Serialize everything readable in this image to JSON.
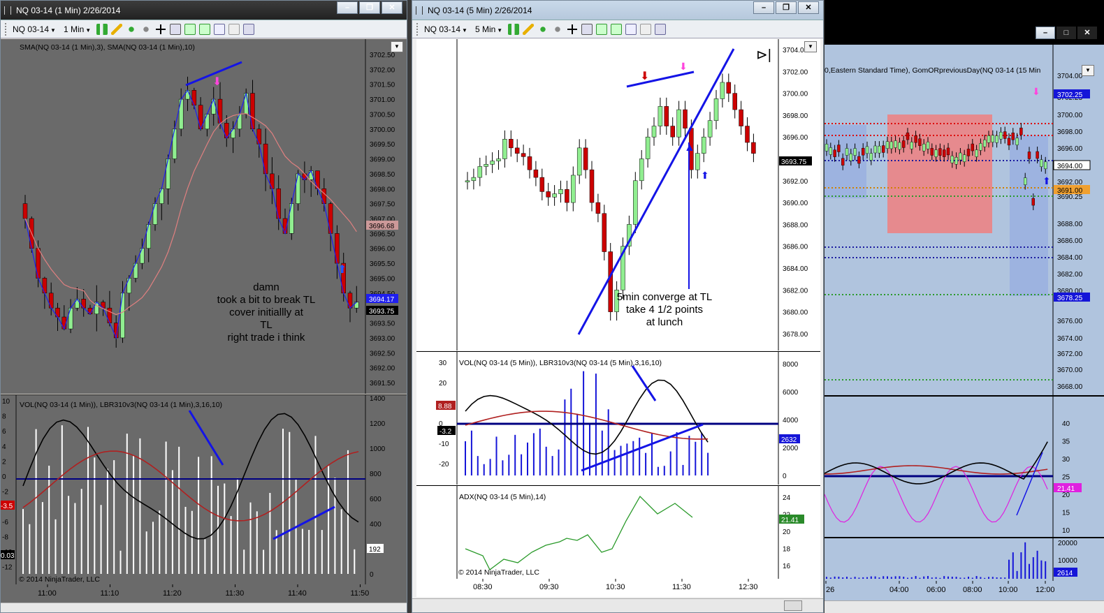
{
  "left": {
    "title": "NQ 03-14 (1 Min)  2/26/2014",
    "instrument": "NQ 03-14",
    "interval": "1 Min",
    "price_label": "SMA(NQ 03-14 (1 Min),3), SMA(NQ 03-14 (1 Min),10)",
    "price_axis": [
      "3702.50",
      "3702.00",
      "3701.50",
      "3701.00",
      "3700.50",
      "3700.00",
      "3699.50",
      "3699.00",
      "3698.50",
      "3698.00",
      "3697.50",
      "3697.00",
      "3696.50",
      "3696.00",
      "3695.50",
      "3695.00",
      "3694.50",
      "3694.00",
      "3693.50",
      "3693.00",
      "3692.50",
      "3692.00",
      "3691.50"
    ],
    "tag_a": "3696.68",
    "tag_b": "3694.17",
    "tag_c": "3693.75",
    "note": [
      "damn",
      "took a bit to break TL",
      "cover initiallly at",
      "TL",
      "right trade i think"
    ],
    "vol_label": "VOL(NQ 03-14 (1 Min)), LBR310v3(NQ 03-14 (1 Min),3,16,10)",
    "vol_left_axis": [
      "10",
      "8",
      "6",
      "4",
      "2",
      "0",
      "-2",
      "-4",
      "-6",
      "-8",
      "-10",
      "-12"
    ],
    "vol_right_axis": [
      "1400",
      "1200",
      "1000",
      "800",
      "600",
      "400",
      "200",
      "0"
    ],
    "vol_tag_left": "-3.5",
    "vol_tag_left2": "0.03",
    "vol_tag_right": "192",
    "copyright": "© 2014 NinjaTrader, LLC",
    "time_axis": [
      "11:00",
      "11:10",
      "11:20",
      "11:30",
      "11:40",
      "11:50"
    ]
  },
  "mid": {
    "title": "NQ 03-14 (5 Min)  2/26/2014",
    "instrument": "NQ 03-14",
    "interval": "5 Min",
    "price_axis": [
      "3704.00",
      "3702.00",
      "3700.00",
      "3698.00",
      "3696.00",
      "3694.00",
      "3692.00",
      "3690.00",
      "3688.00",
      "3686.00",
      "3684.00",
      "3682.00",
      "3680.00",
      "3678.00"
    ],
    "tag_price": "3693.75",
    "note": [
      "5min converge at TL",
      "take 4 1/2 points",
      "at lunch"
    ],
    "vol_label": "VOL(NQ 03-14 (5 Min)), LBR310v3(NQ 03-14 (5 Min),3,16,10)",
    "vol_left_axis": [
      "30",
      "20",
      "10",
      "0",
      "-10",
      "-20"
    ],
    "vol_right_axis": [
      "8000",
      "6000",
      "4000",
      "2000",
      "0"
    ],
    "vol_tag_a": "8.88",
    "vol_tag_b": "-3.2",
    "vol_tag_c": "2632",
    "adx_label": "ADX(NQ 03-14 (5 Min),14)",
    "adx_axis": [
      "24",
      "22",
      "20",
      "18",
      "16"
    ],
    "adx_tag": "21.41",
    "copyright": "© 2014 NinjaTrader, LLC",
    "time_axis": [
      "08:30",
      "09:30",
      "10:30",
      "11:30",
      "12:30"
    ]
  },
  "right": {
    "label": "0,Eastern Standard Time), GomORpreviousDay(NQ 03-14 (15 Min",
    "price_axis": [
      "3704.00",
      "3702.25",
      "3700.00",
      "3698.00",
      "3696.00",
      "3694.00",
      "3692.00",
      "3691.00",
      "3690.25",
      "3688.00",
      "3686.00",
      "3684.00",
      "3682.00",
      "3680.00",
      "3678.25",
      "3676.00",
      "3674.00",
      "3672.00",
      "3670.00",
      "3668.00"
    ],
    "osc_axis": [
      "40",
      "35",
      "30",
      "25",
      "20",
      "15",
      "10"
    ],
    "osc_tag": "21.41",
    "vol_axis": [
      "20000",
      "10000"
    ],
    "vol_tag": "2614",
    "time_axis": [
      "26",
      "04:00",
      "06:00",
      "08:00",
      "10:00",
      "12:00"
    ]
  },
  "colors": {
    "up": "#90ee90",
    "down": "#cc0000",
    "sma_fast": "#1e1ef0",
    "sma_slow": "#e08080",
    "trend": "#1414e6"
  }
}
